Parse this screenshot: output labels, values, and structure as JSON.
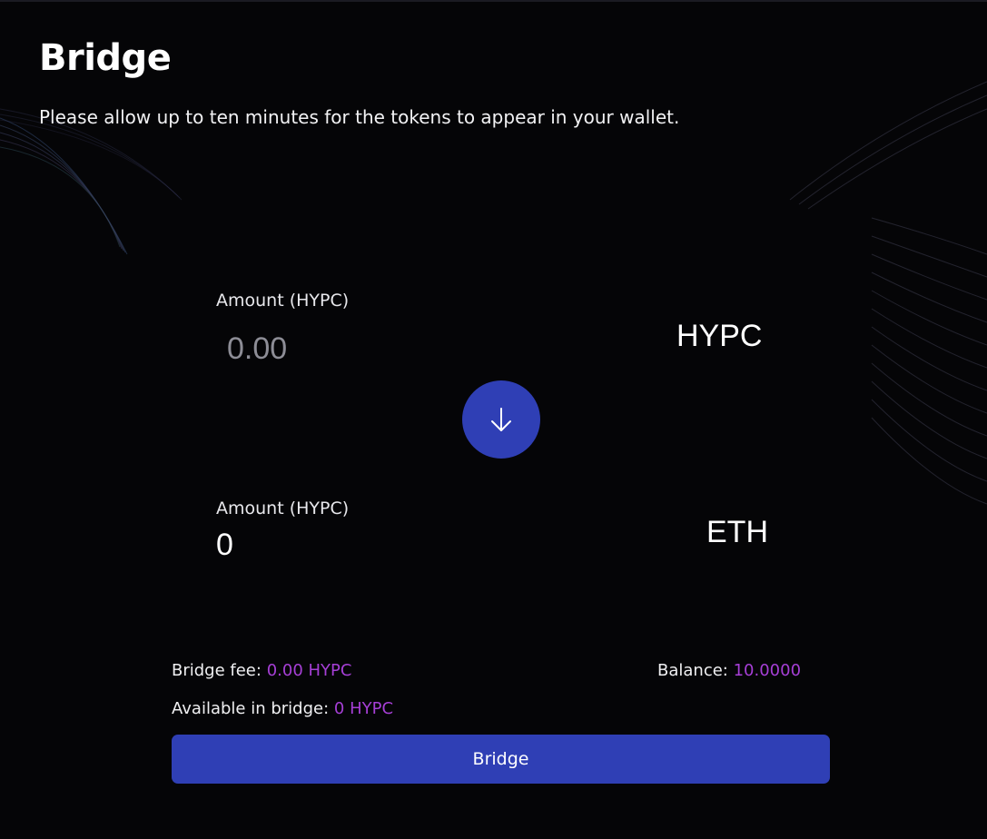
{
  "page": {
    "title": "Bridge",
    "subtitle": "Please allow up to ten minutes for the tokens to appear in your wallet."
  },
  "from": {
    "label": "Amount (HYPC)",
    "placeholder": "0.00",
    "value": "",
    "token": "HYPC"
  },
  "to": {
    "label": "Amount (HYPC)",
    "amount": "0",
    "token": "ETH"
  },
  "swap": {
    "icon": "arrow-down-icon"
  },
  "info": {
    "fee_label": "Bridge fee:",
    "fee_value": "0.00 HYPC",
    "balance_label": "Balance:",
    "balance_value": "10.0000",
    "available_label": "Available in bridge:",
    "available_value": "0 HYPC"
  },
  "actions": {
    "bridge_label": "Bridge"
  },
  "colors": {
    "background": "#050507",
    "accent": "#2f3fb5",
    "highlight": "#a63fd6"
  }
}
